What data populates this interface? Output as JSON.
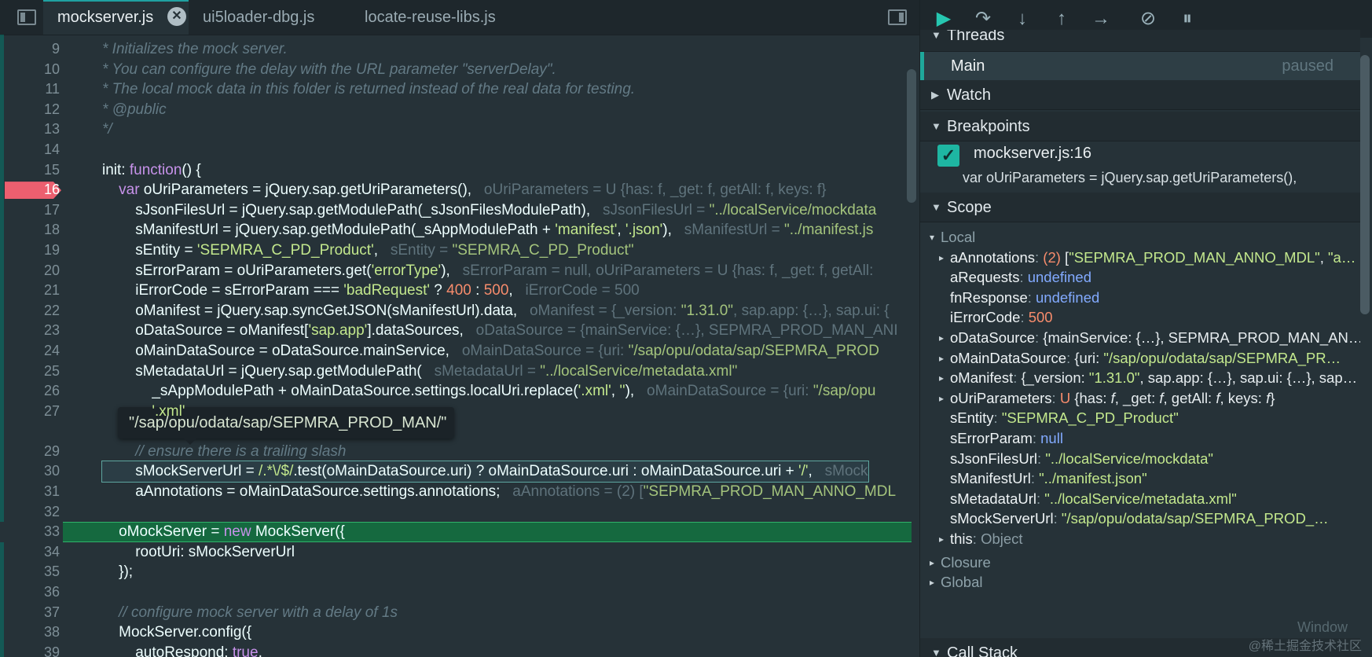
{
  "tabs": [
    {
      "label": "mockserver.js",
      "active": true
    },
    {
      "label": "ui5loader-dbg.js",
      "active": false
    },
    {
      "label": "locate-reuse-libs.js",
      "active": false
    }
  ],
  "tab_close_glyph": "✕",
  "icons": {
    "toggle_left": "sidebar-left-icon",
    "toggle_right": "sidebar-right-icon",
    "resume": "▶",
    "step_over": "↷",
    "step_in": "↓",
    "step_out": "↑",
    "step": "→",
    "deactivate": "⊘",
    "pause_exc": "⏸"
  },
  "code_lines": [
    {
      "n": "9",
      "html": "<span class='cmt'>* Initializes the mock server.</span>"
    },
    {
      "n": "10",
      "html": "<span class='cmt'>* You can configure the delay with the URL parameter \"serverDelay\".</span>"
    },
    {
      "n": "11",
      "html": "<span class='cmt'>* The local mock data in this folder is returned instead of the real data for testing.</span>"
    },
    {
      "n": "12",
      "html": "<span class='cmt'>* @public</span>"
    },
    {
      "n": "13",
      "html": "<span class='cmt'>*/</span>"
    },
    {
      "n": "14",
      "html": ""
    },
    {
      "n": "15",
      "html": "init: <span class='kw'>function</span>() {"
    },
    {
      "n": "16",
      "html": "    <span class='kw'>var</span> oUriParameters = jQuery.sap.getUriParameters(),   <span class='inl'>oUriParameters = U {has: f, _get: f, getAll: f, keys: f}</span>",
      "bp": true
    },
    {
      "n": "17",
      "html": "        sJsonFilesUrl = jQuery.sap.getModulePath(_sJsonFilesModulePath),   <span class='inl'>sJsonFilesUrl = <span class='s'>\"../localService/mockdata</span></span>"
    },
    {
      "n": "18",
      "html": "        sManifestUrl = jQuery.sap.getModulePath(_sAppModulePath + <span class='str'>'manifest'</span>, <span class='str'>'.json'</span>),   <span class='inl'>sManifestUrl = <span class='s'>\"../manifest.js</span></span>"
    },
    {
      "n": "19",
      "html": "        sEntity = <span class='str'>'SEPMRA_C_PD_Product'</span>,   <span class='inl'>sEntity = <span class='s'>\"SEPMRA_C_PD_Product\"</span></span>"
    },
    {
      "n": "20",
      "html": "        sErrorParam = oUriParameters.get(<span class='str'>'errorType'</span>),   <span class='inl'>sErrorParam = null, oUriParameters = U {has: f, _get: f, getAll:</span>"
    },
    {
      "n": "21",
      "html": "        iErrorCode = sErrorParam === <span class='str'>'badRequest'</span> ? <span class='num'>400</span> : <span class='num'>500</span>,   <span class='inl'>iErrorCode = 500</span>"
    },
    {
      "n": "22",
      "html": "        oManifest = jQuery.sap.syncGetJSON(sManifestUrl).data,   <span class='inl'>oManifest = {_version: <span class='s'>\"1.31.0\"</span>, sap.app: {…}, sap.ui: {</span>"
    },
    {
      "n": "23",
      "html": "        oDataSource = oManifest[<span class='str'>'sap.app'</span>].dataSources,   <span class='inl'>oDataSource = {mainService: {…}, SEPMRA_PROD_MAN_ANI</span>"
    },
    {
      "n": "24",
      "html": "        oMainDataSource = oDataSource.mainService,   <span class='inl'>oMainDataSource = {uri: <span class='s'>\"/sap/opu/odata/sap/SEPMRA_PROD</span></span>"
    },
    {
      "n": "25",
      "html": "        sMetadataUrl = jQuery.sap.getModulePath(   <span class='inl'>sMetadataUrl = <span class='s'>\"../localService/metadata.xml\"</span></span>"
    },
    {
      "n": "26",
      "html": "            _sAppModulePath + oMainDataSource.settings.localUri.replace(<span class='str'>'.xml'</span>, <span class='str'>''</span>),   <span class='inl'>oMainDataSource = {uri: <span class='s'>\"/sap/opu</span></span>"
    },
    {
      "n": "27",
      "html": "            <span class='str'>'.xml'</span>",
      "tooltip_row": false
    },
    {
      "n": "28",
      "html": "",
      "tooltip_row": true
    },
    {
      "n": "29",
      "html": "        <span class='cmt'>// ensure there is a trailing slash</span>"
    },
    {
      "n": "30",
      "html": "        sMockServerUrl = <span class='str'>/.*\\/$/</span>.test(oMainDataSource.uri) ? oMainDataSource.uri : oMainDataSource.uri + <span class='str'>'/'</span>,   <span class='inl'>sMock</span>",
      "sel": true
    },
    {
      "n": "31",
      "html": "        aAnnotations = oMainDataSource.settings.annotations;   <span class='inl'>aAnnotations = (2) [<span class='s'>\"SEPMRA_PROD_MAN_ANNO_MDL</span></span>"
    },
    {
      "n": "32",
      "html": ""
    },
    {
      "n": "33",
      "html": "    oMockServer = <span class='kw'>new</span> MockServer({",
      "exec": true
    },
    {
      "n": "34",
      "html": "        rootUri: sMockServerUrl"
    },
    {
      "n": "35",
      "html": "    });"
    },
    {
      "n": "36",
      "html": ""
    },
    {
      "n": "37",
      "html": "    <span class='cmt'>// configure mock server with a delay of 1s</span>"
    },
    {
      "n": "38",
      "html": "    MockServer.config({"
    },
    {
      "n": "39",
      "html": "        autoRespond: <span class='kw'>true</span>,"
    }
  ],
  "hover_tooltip": "\"/sap/opu/odata/sap/SEPMRA_PROD_MAN/\"",
  "debugger": {
    "threads_label": "Threads",
    "thread_name": "Main",
    "thread_status": "paused",
    "watch_label": "Watch",
    "breakpoints_label": "Breakpoints",
    "breakpoint_location": "mockserver.js:16",
    "breakpoint_source": "var oUriParameters = jQuery.sap.getUriParameters(),",
    "scope_label": "Scope",
    "callstack_label": "Call Stack",
    "window_label": "Window",
    "checkbox_glyph": "✓"
  },
  "scope_rows": [
    {
      "indent": 0,
      "twisty": "▾",
      "html": "<span class='grp'>Local</span>"
    },
    {
      "indent": 1,
      "twisty": "▸",
      "html": "<span class='k'>aAnnotations</span><span class='p'>:</span> <span class='v-num'>(2)</span> [<span class='v-str'>\"SEPMRA_PROD_MAN_ANNO_MDL\"</span>, <span class='v-str'>\"a…</span>"
    },
    {
      "indent": 1,
      "twisty": "",
      "html": "<span class='k'>aRequests</span><span class='p'>:</span> <span class='v-und'>undefined</span>"
    },
    {
      "indent": 1,
      "twisty": "",
      "html": "<span class='k'>fnResponse</span><span class='p'>:</span> <span class='v-und'>undefined</span>"
    },
    {
      "indent": 1,
      "twisty": "",
      "html": "<span class='k'>iErrorCode</span><span class='p'>:</span> <span class='v-num'>500</span>"
    },
    {
      "indent": 1,
      "twisty": "▸",
      "html": "<span class='k'>oDataSource</span><span class='p'>:</span> {mainService: {…}, SEPMRA_PROD_MAN_AN…"
    },
    {
      "indent": 1,
      "twisty": "▸",
      "html": "<span class='k'>oMainDataSource</span><span class='p'>:</span> {uri: <span class='v-str'>\"/sap/opu/odata/sap/SEPMRA_PR…</span>"
    },
    {
      "indent": 1,
      "twisty": "▸",
      "html": "<span class='k'>oManifest</span><span class='p'>:</span> {_version: <span class='v-str'>\"1.31.0\"</span>, sap.app: {…}, sap.ui: {…}, sap…"
    },
    {
      "indent": 1,
      "twisty": "▸",
      "html": "<span class='k'>oUriParameters</span><span class='p'>:</span> <span class='v-num'>U</span> {has: <i>f</i>, _get: <i>f</i>, getAll: <i>f</i>, keys: <i>f</i>}"
    },
    {
      "indent": 1,
      "twisty": "",
      "html": "<span class='k'>sEntity</span><span class='p'>:</span> <span class='v-str'>\"SEPMRA_C_PD_Product\"</span>"
    },
    {
      "indent": 1,
      "twisty": "",
      "html": "<span class='k'>sErrorParam</span><span class='p'>:</span> <span class='v-null'>null</span>"
    },
    {
      "indent": 1,
      "twisty": "",
      "html": "<span class='k'>sJsonFilesUrl</span><span class='p'>:</span> <span class='v-str'>\"../localService/mockdata\"</span>"
    },
    {
      "indent": 1,
      "twisty": "",
      "html": "<span class='k'>sManifestUrl</span><span class='p'>:</span> <span class='v-str'>\"../manifest.json\"</span>"
    },
    {
      "indent": 1,
      "twisty": "",
      "html": "<span class='k'>sMetadataUrl</span><span class='p'>:</span> <span class='v-str'>\"../localService/metadata.xml\"</span>"
    },
    {
      "indent": 1,
      "twisty": "",
      "html": "<span class='k'>sMockServerUrl</span><span class='p'>:</span> <span class='v-str'>\"/sap/opu/odata/sap/SEPMRA_PROD_…</span>"
    },
    {
      "indent": 1,
      "twisty": "▸",
      "html": "<span class='k'>this</span><span class='p'>:</span> <span class='p'>Object</span>"
    },
    {
      "indent": 0,
      "twisty": "▸",
      "html": "<span class='grp'>Closure</span>"
    },
    {
      "indent": 0,
      "twisty": "▸",
      "html": "<span class='grp'>Global</span>"
    }
  ],
  "watermark": "@稀土掘金技术社区",
  "colors": {
    "accent": "#1fa89b",
    "breakpoint": "#ec5f6f",
    "exec_line": "#15693f"
  }
}
